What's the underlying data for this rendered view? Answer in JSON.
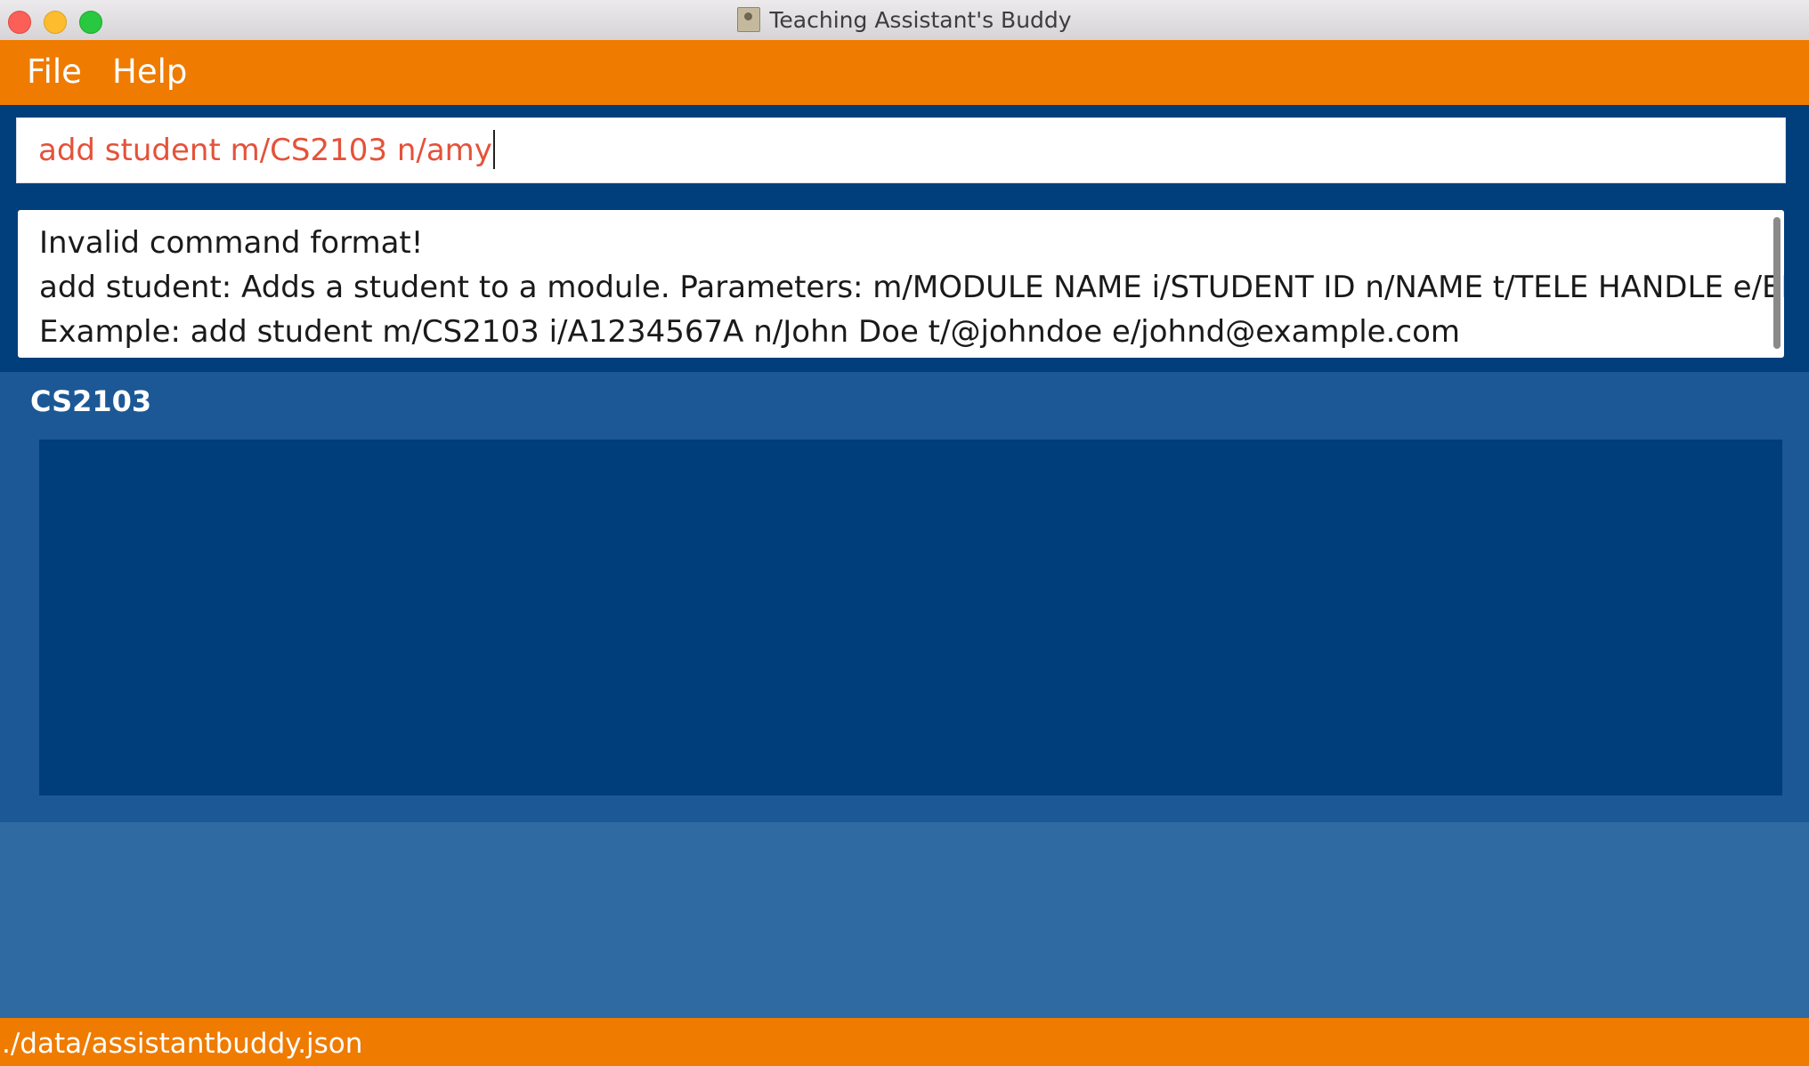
{
  "window": {
    "title": "Teaching Assistant's Buddy"
  },
  "menu": {
    "file_label": "File",
    "help_label": "Help"
  },
  "command": {
    "value": "add student m/CS2103 n/amy",
    "text_color": "#e4523a"
  },
  "result": {
    "lines": [
      "Invalid command format!",
      "add student: Adds a student to a module. Parameters: m/MODULE NAME i/STUDENT ID n/NAME t/TELE HANDLE e/EMAIL",
      "Example: add student m/CS2103 i/A1234567A n/John Doe t/@johndoe e/johnd@example.com"
    ]
  },
  "module": {
    "name": "CS2103",
    "students": []
  },
  "status": {
    "file_path": "./data/assistantbuddy.json"
  },
  "colors": {
    "accent": "#ef7b00",
    "command_bg": "#003e7c",
    "module_panel_bg": "#1c5895",
    "student_list_bg": "#003d7b",
    "main_bg": "#2f6aa2"
  }
}
